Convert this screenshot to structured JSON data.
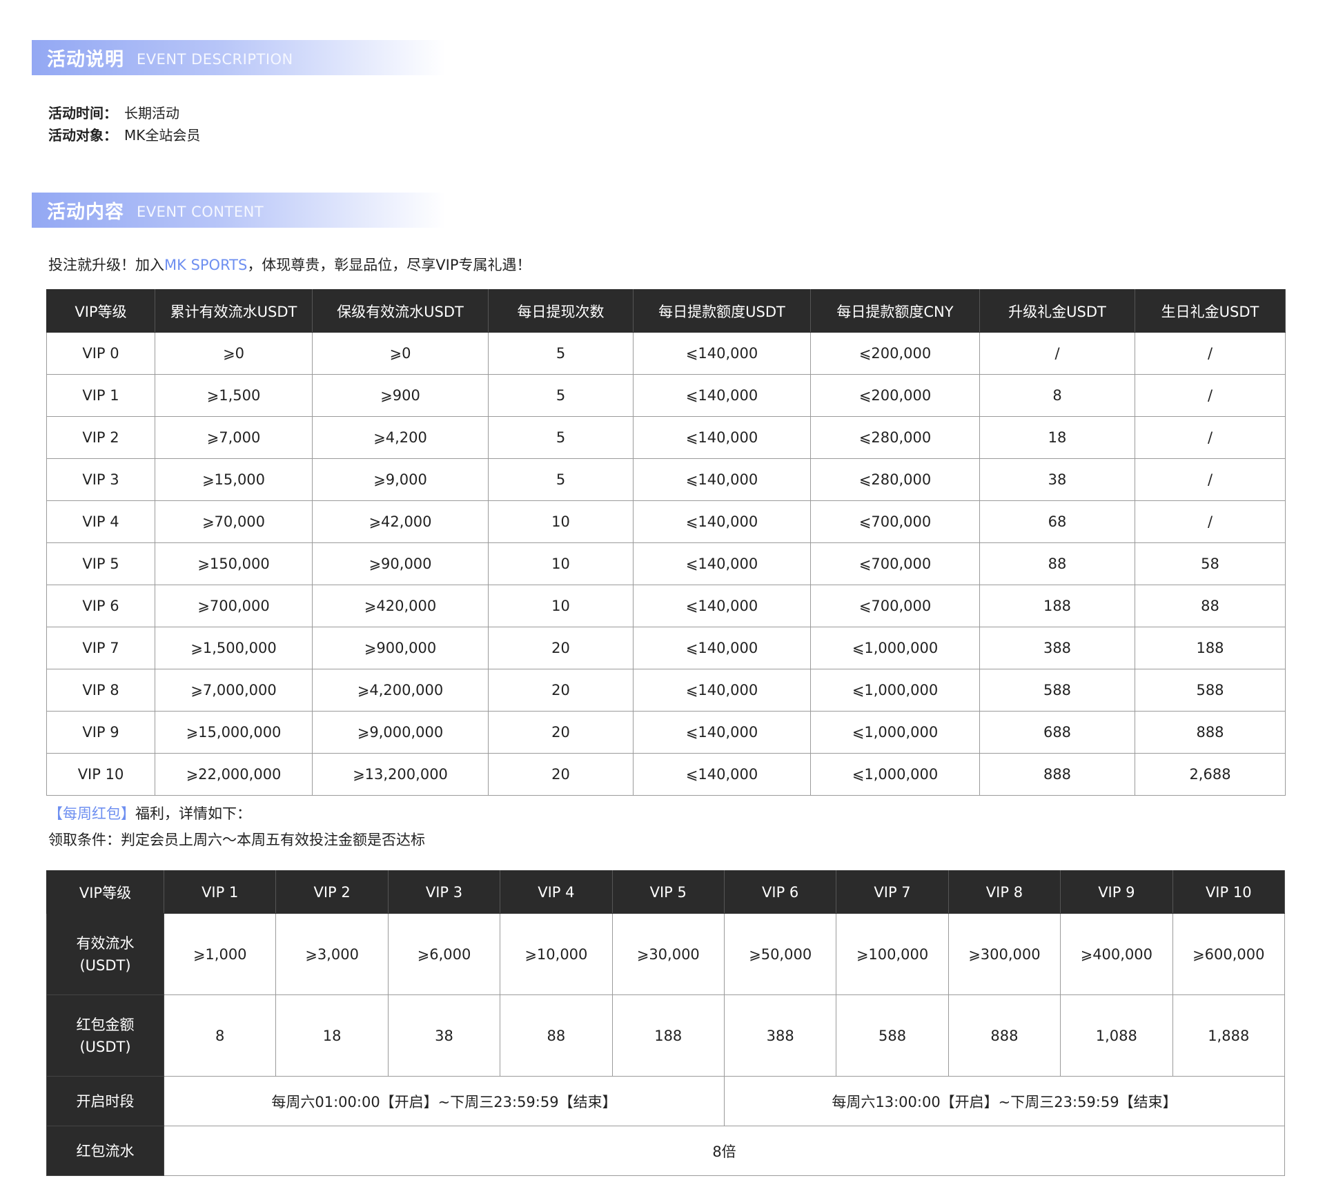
{
  "desc_header": {
    "zh": "活动说明",
    "en": "EVENT DESCRIPTION"
  },
  "info": [
    {
      "key": "活动时间：",
      "value": "长期活动"
    },
    {
      "key": "活动对象：",
      "value": "MK全站会员"
    }
  ],
  "content_header": {
    "zh": "活动内容",
    "en": "EVENT CONTENT"
  },
  "intro": {
    "pre": "投注就升级！加入",
    "brand": "MK SPORTS",
    "post": "，体现尊贵，彰显品位，尽享VIP专属礼遇！"
  },
  "vip_table": {
    "headers": [
      "VIP等级",
      "累计有效流水USDT",
      "保级有效流水USDT",
      "每日提现次数",
      "每日提款额度USDT",
      "每日提款额度CNY",
      "升级礼金USDT",
      "生日礼金USDT"
    ],
    "rows": [
      [
        "VIP 0",
        "⩾0",
        "⩾0",
        "5",
        "⩽140,000",
        "⩽200,000",
        "/",
        "/"
      ],
      [
        "VIP 1",
        "⩾1,500",
        "⩾900",
        "5",
        "⩽140,000",
        "⩽200,000",
        "8",
        "/"
      ],
      [
        "VIP 2",
        "⩾7,000",
        "⩾4,200",
        "5",
        "⩽140,000",
        "⩽280,000",
        "18",
        "/"
      ],
      [
        "VIP 3",
        "⩾15,000",
        "⩾9,000",
        "5",
        "⩽140,000",
        "⩽280,000",
        "38",
        "/"
      ],
      [
        "VIP 4",
        "⩾70,000",
        "⩾42,000",
        "10",
        "⩽140,000",
        "⩽700,000",
        "68",
        "/"
      ],
      [
        "VIP 5",
        "⩾150,000",
        "⩾90,000",
        "10",
        "⩽140,000",
        "⩽700,000",
        "88",
        "58"
      ],
      [
        "VIP 6",
        "⩾700,000",
        "⩾420,000",
        "10",
        "⩽140,000",
        "⩽700,000",
        "188",
        "88"
      ],
      [
        "VIP 7",
        "⩾1,500,000",
        "⩾900,000",
        "20",
        "⩽140,000",
        "⩽1,000,000",
        "388",
        "188"
      ],
      [
        "VIP 8",
        "⩾7,000,000",
        "⩾4,200,000",
        "20",
        "⩽140,000",
        "⩽1,000,000",
        "588",
        "588"
      ],
      [
        "VIP 9",
        "⩾15,000,000",
        "⩾9,000,000",
        "20",
        "⩽140,000",
        "⩽1,000,000",
        "688",
        "888"
      ],
      [
        "VIP 10",
        "⩾22,000,000",
        "⩾13,200,000",
        "20",
        "⩽140,000",
        "⩽1,000,000",
        "888",
        "2,688"
      ]
    ]
  },
  "notes": {
    "tag": "【每周红包】",
    "tag_post": "福利，详情如下：",
    "condition": "领取条件：判定会员上周六～本周五有效投注金额是否达标"
  },
  "red_table": {
    "headers": [
      "VIP等级",
      "VIP 1",
      "VIP 2",
      "VIP 3",
      "VIP 4",
      "VIP 5",
      "VIP 6",
      "VIP 7",
      "VIP 8",
      "VIP 9",
      "VIP 10"
    ],
    "turnover_label": [
      "有效流水",
      "(USDT)"
    ],
    "turnover": [
      "⩾1,000",
      "⩾3,000",
      "⩾6,000",
      "⩾10,000",
      "⩾30,000",
      "⩾50,000",
      "⩾100,000",
      "⩾300,000",
      "⩾400,000",
      "⩾600,000"
    ],
    "amount_label": [
      "红包金额",
      "(USDT)"
    ],
    "amount": [
      "8",
      "18",
      "38",
      "88",
      "188",
      "388",
      "588",
      "888",
      "1,088",
      "1,888"
    ],
    "open_label": "开启时段",
    "open_a": "每周六01:00:00【开启】~下周三23:59:59【结束】",
    "open_b": "每周六13:00:00【开启】~下周三23:59:59【结束】",
    "wager_label": "红包流水",
    "wager": "8倍"
  },
  "colors": {
    "accent": "#6e8ff0",
    "header_bg": "#2b2b2b",
    "banner": "#93a8f3"
  }
}
